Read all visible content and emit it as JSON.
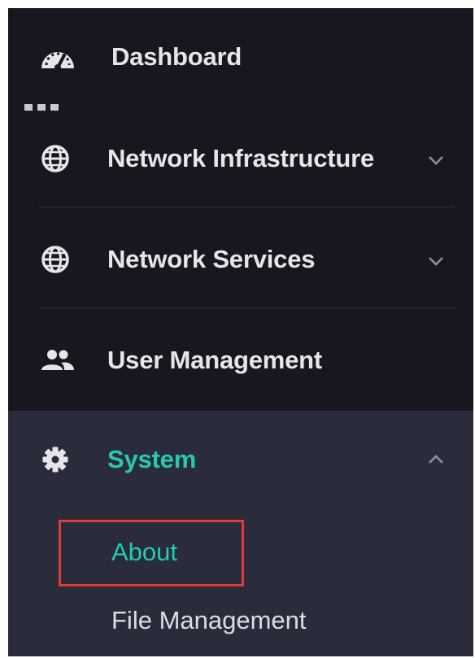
{
  "sidebar": {
    "items": [
      {
        "label": "Dashboard",
        "icon": "dashboard-gauge-icon"
      },
      {
        "label": "Network Infrastructure",
        "icon": "globe-icon",
        "chevron": "chevron-down-icon"
      },
      {
        "label": "Network Services",
        "icon": "globe-icon",
        "chevron": "chevron-down-icon"
      },
      {
        "label": "User Management",
        "icon": "users-icon"
      },
      {
        "label": "System",
        "icon": "gear-icon",
        "chevron": "chevron-up-icon",
        "expanded": true,
        "active": true
      }
    ],
    "system_subitems": [
      {
        "label": "About",
        "selected": true
      },
      {
        "label": "File Management"
      }
    ]
  },
  "colors": {
    "sidebar_bg": "#17171f",
    "expanded_bg": "#2a2b3b",
    "text": "#e6e6ea",
    "accent": "#27c9b0",
    "highlight_border": "#e23b3b",
    "divider": "#34343f"
  }
}
